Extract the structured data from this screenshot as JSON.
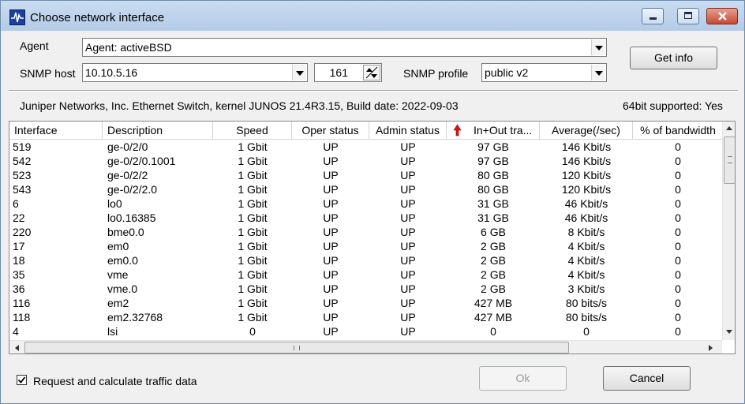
{
  "window": {
    "title": "Choose network interface",
    "app_icon": "network-pulse-icon",
    "controls": [
      "minimize-icon",
      "maximize-icon",
      "close-icon"
    ]
  },
  "form": {
    "agent_label": "Agent",
    "agent_value": "Agent: activeBSD",
    "snmp_host_label": "SNMP host",
    "snmp_host_value": "10.10.5.16",
    "port_value": "161",
    "snmp_profile_label": "SNMP profile",
    "snmp_profile_value": "public v2",
    "get_info_label": "Get info"
  },
  "info": {
    "device": "Juniper Networks, Inc. Ethernet Switch, kernel JUNOS 21.4R3.15, Build date: 2022-09-03",
    "bits": "64bit supported: Yes"
  },
  "table": {
    "columns": [
      "Interface",
      "Description",
      "Speed",
      "Oper status",
      "Admin status",
      "In+Out tra...",
      "Average(/sec)",
      "% of bandwidth"
    ],
    "sort_icon": "sort-descending-red-arrow-icon",
    "rows": [
      [
        "519",
        "ge-0/2/0",
        "1 Gbit",
        "UP",
        "UP",
        "97 GB",
        "146 Kbit/s",
        "0"
      ],
      [
        "542",
        "ge-0/2/0.1001",
        "1 Gbit",
        "UP",
        "UP",
        "97 GB",
        "146 Kbit/s",
        "0"
      ],
      [
        "523",
        "ge-0/2/2",
        "1 Gbit",
        "UP",
        "UP",
        "80 GB",
        "120 Kbit/s",
        "0"
      ],
      [
        "543",
        "ge-0/2/2.0",
        "1 Gbit",
        "UP",
        "UP",
        "80 GB",
        "120 Kbit/s",
        "0"
      ],
      [
        "6",
        "lo0",
        "1 Gbit",
        "UP",
        "UP",
        "31 GB",
        "46 Kbit/s",
        "0"
      ],
      [
        "22",
        "lo0.16385",
        "1 Gbit",
        "UP",
        "UP",
        "31 GB",
        "46 Kbit/s",
        "0"
      ],
      [
        "220",
        "bme0.0",
        "1 Gbit",
        "UP",
        "UP",
        "6 GB",
        "8 Kbit/s",
        "0"
      ],
      [
        "17",
        "em0",
        "1 Gbit",
        "UP",
        "UP",
        "2 GB",
        "4 Kbit/s",
        "0"
      ],
      [
        "18",
        "em0.0",
        "1 Gbit",
        "UP",
        "UP",
        "2 GB",
        "4 Kbit/s",
        "0"
      ],
      [
        "35",
        "vme",
        "1 Gbit",
        "UP",
        "UP",
        "2 GB",
        "4 Kbit/s",
        "0"
      ],
      [
        "36",
        "vme.0",
        "1 Gbit",
        "UP",
        "UP",
        "2 GB",
        "3 Kbit/s",
        "0"
      ],
      [
        "116",
        "em2",
        "1 Gbit",
        "UP",
        "UP",
        "427 MB",
        "80 bits/s",
        "0"
      ],
      [
        "118",
        "em2.32768",
        "1 Gbit",
        "UP",
        "UP",
        "427 MB",
        "80 bits/s",
        "0"
      ],
      [
        "4",
        "lsi",
        "0",
        "UP",
        "UP",
        "0",
        "0",
        "0"
      ]
    ]
  },
  "footer": {
    "checkbox_label": "Request and calculate traffic data",
    "checkbox_checked": true,
    "ok_label": "Ok",
    "cancel_label": "Cancel"
  }
}
